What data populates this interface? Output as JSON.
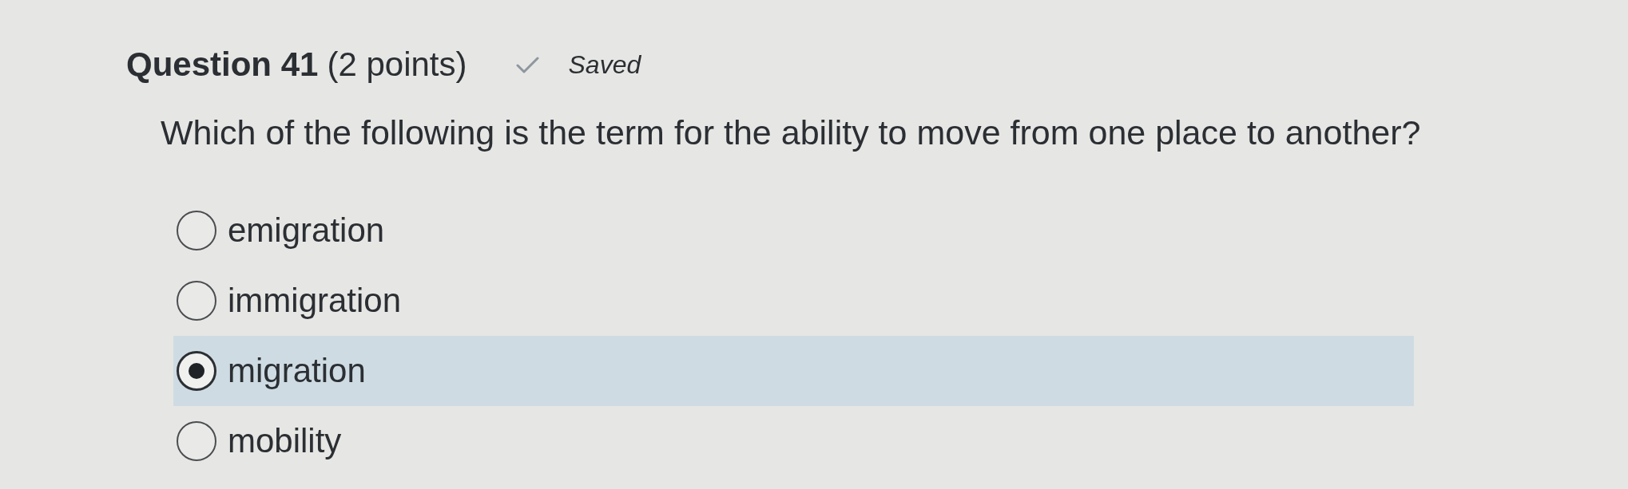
{
  "question": {
    "title": "Question 41",
    "points": "(2 points)",
    "status": "Saved"
  },
  "prompt": "Which of the following is the term for the ability to move from one place to another?",
  "options": [
    {
      "label": "emigration",
      "selected": false
    },
    {
      "label": "immigration",
      "selected": false
    },
    {
      "label": "migration",
      "selected": true
    },
    {
      "label": "mobility",
      "selected": false
    }
  ]
}
